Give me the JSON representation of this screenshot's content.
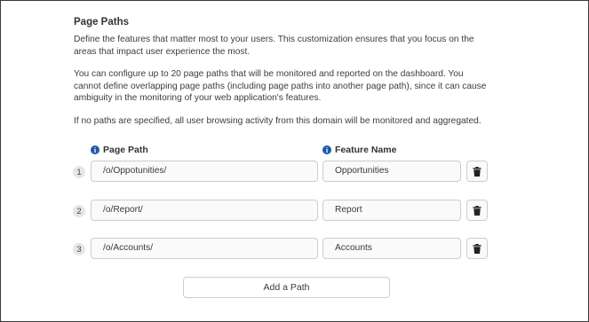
{
  "section": {
    "title": "Page Paths",
    "paragraphs": [
      "Define the features that matter most to your users. This customization ensures that you focus on the areas that impact user experience the most.",
      "You can configure up to 20 page paths that will be monitored and reported on the dashboard. You cannot define overlapping page paths (including page paths into another page path), since it can cause ambiguity in the monitoring of your web application's features.",
      "If no paths are specified, all user browsing activity from this domain will be monitored and aggregated."
    ]
  },
  "columns": {
    "page_path_label": "Page Path",
    "feature_name_label": "Feature Name",
    "info_icon": "info-icon"
  },
  "rows": [
    {
      "number": "1",
      "page_path": "/o/Oppotunities/",
      "feature_name": "Opportunities"
    },
    {
      "number": "2",
      "page_path": "/o/Report/",
      "feature_name": "Report"
    },
    {
      "number": "3",
      "page_path": "/o/Accounts/",
      "feature_name": "Accounts"
    }
  ],
  "add_button_label": "Add a Path",
  "colors": {
    "info_blue": "#1e5aa8",
    "trash_icon": "#222222",
    "border": "#c9cdd3"
  }
}
